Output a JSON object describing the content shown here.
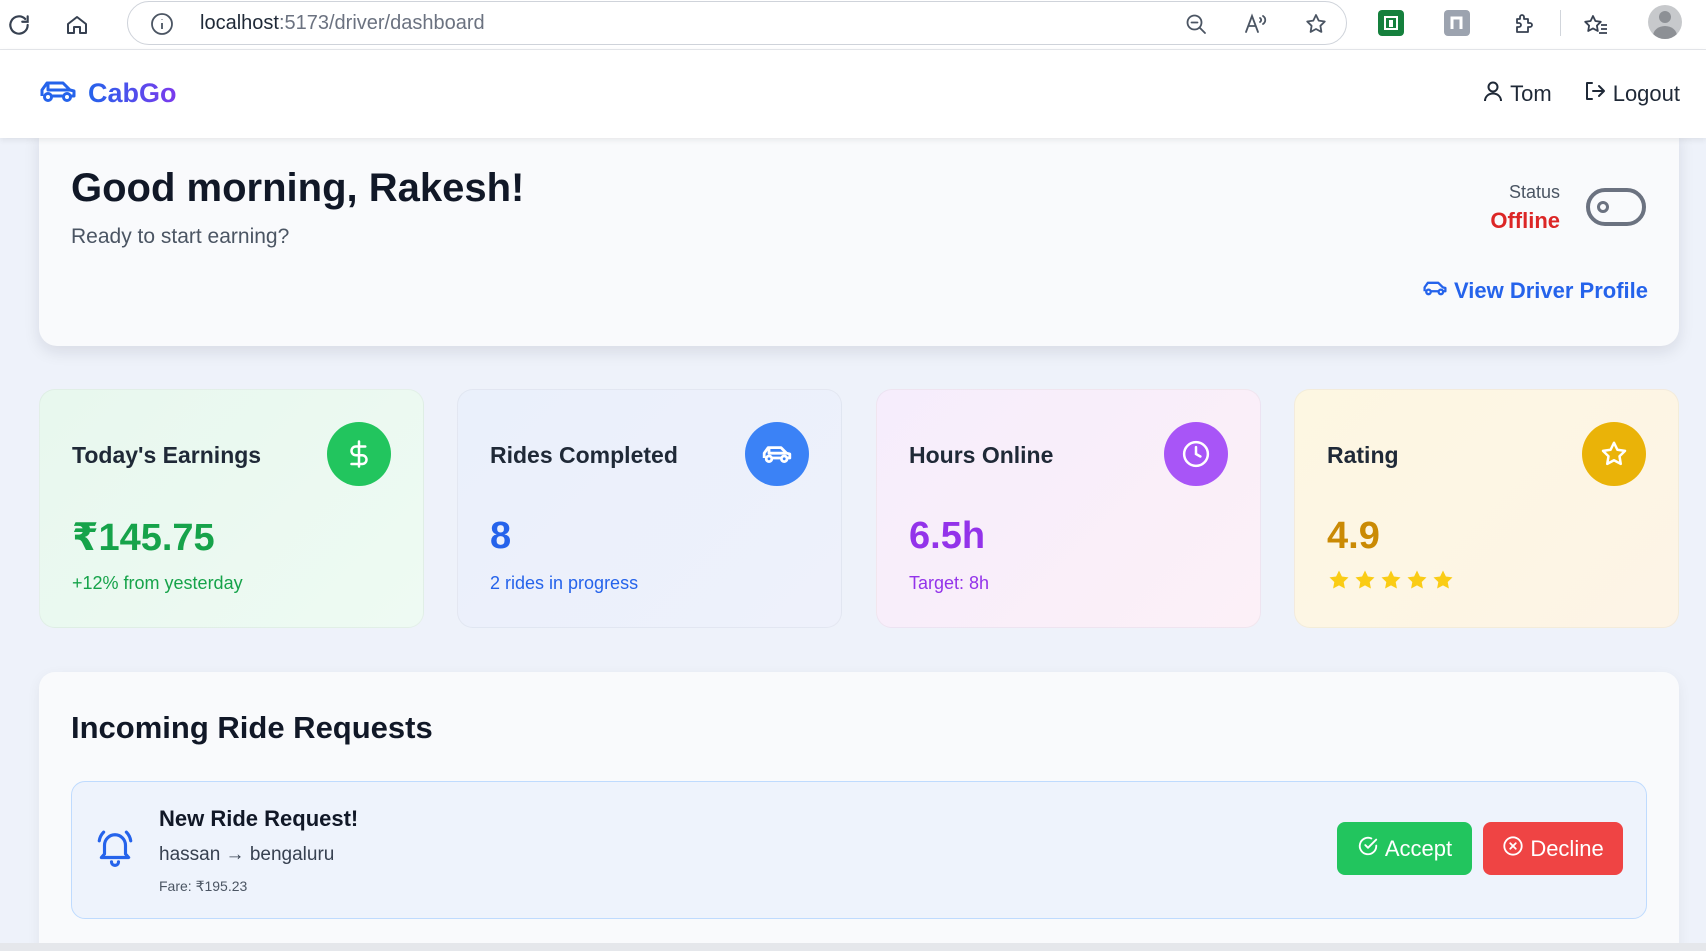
{
  "browser": {
    "url_host": "localhost",
    "url_path": ":5173/driver/dashboard"
  },
  "nav": {
    "brand": "CabGo",
    "user_name": "Tom",
    "logout_label": "Logout"
  },
  "welcome": {
    "greeting": "Good morning, Rakesh!",
    "subtitle": "Ready to start earning?",
    "status_label": "Status",
    "status_value": "Offline",
    "profile_link": "View Driver Profile"
  },
  "stats": {
    "earnings": {
      "title": "Today's Earnings",
      "value": "₹145.75",
      "note": "+12% from yesterday"
    },
    "rides": {
      "title": "Rides Completed",
      "value": "8",
      "note": "2 rides in progress"
    },
    "hours": {
      "title": "Hours Online",
      "value": "6.5h",
      "note": "Target: 8h"
    },
    "rating": {
      "title": "Rating",
      "value": "4.9",
      "stars": 5
    }
  },
  "requests": {
    "heading": "Incoming Ride Requests",
    "item": {
      "title": "New Ride Request!",
      "route": "hassan → bengaluru",
      "fare": "Fare: ₹195.23"
    },
    "accept_label": "Accept",
    "decline_label": "Decline"
  },
  "colors": {
    "brand_blue": "#2563eb",
    "brand_purple": "#7c3aed",
    "earnings_green": "#16a34a",
    "rides_blue": "#2563eb",
    "hours_purple": "#9333ea",
    "rating_gold": "#ca8a04",
    "offline_red": "#dc2626",
    "accept_green": "#22c55e",
    "decline_red": "#ef4444"
  }
}
